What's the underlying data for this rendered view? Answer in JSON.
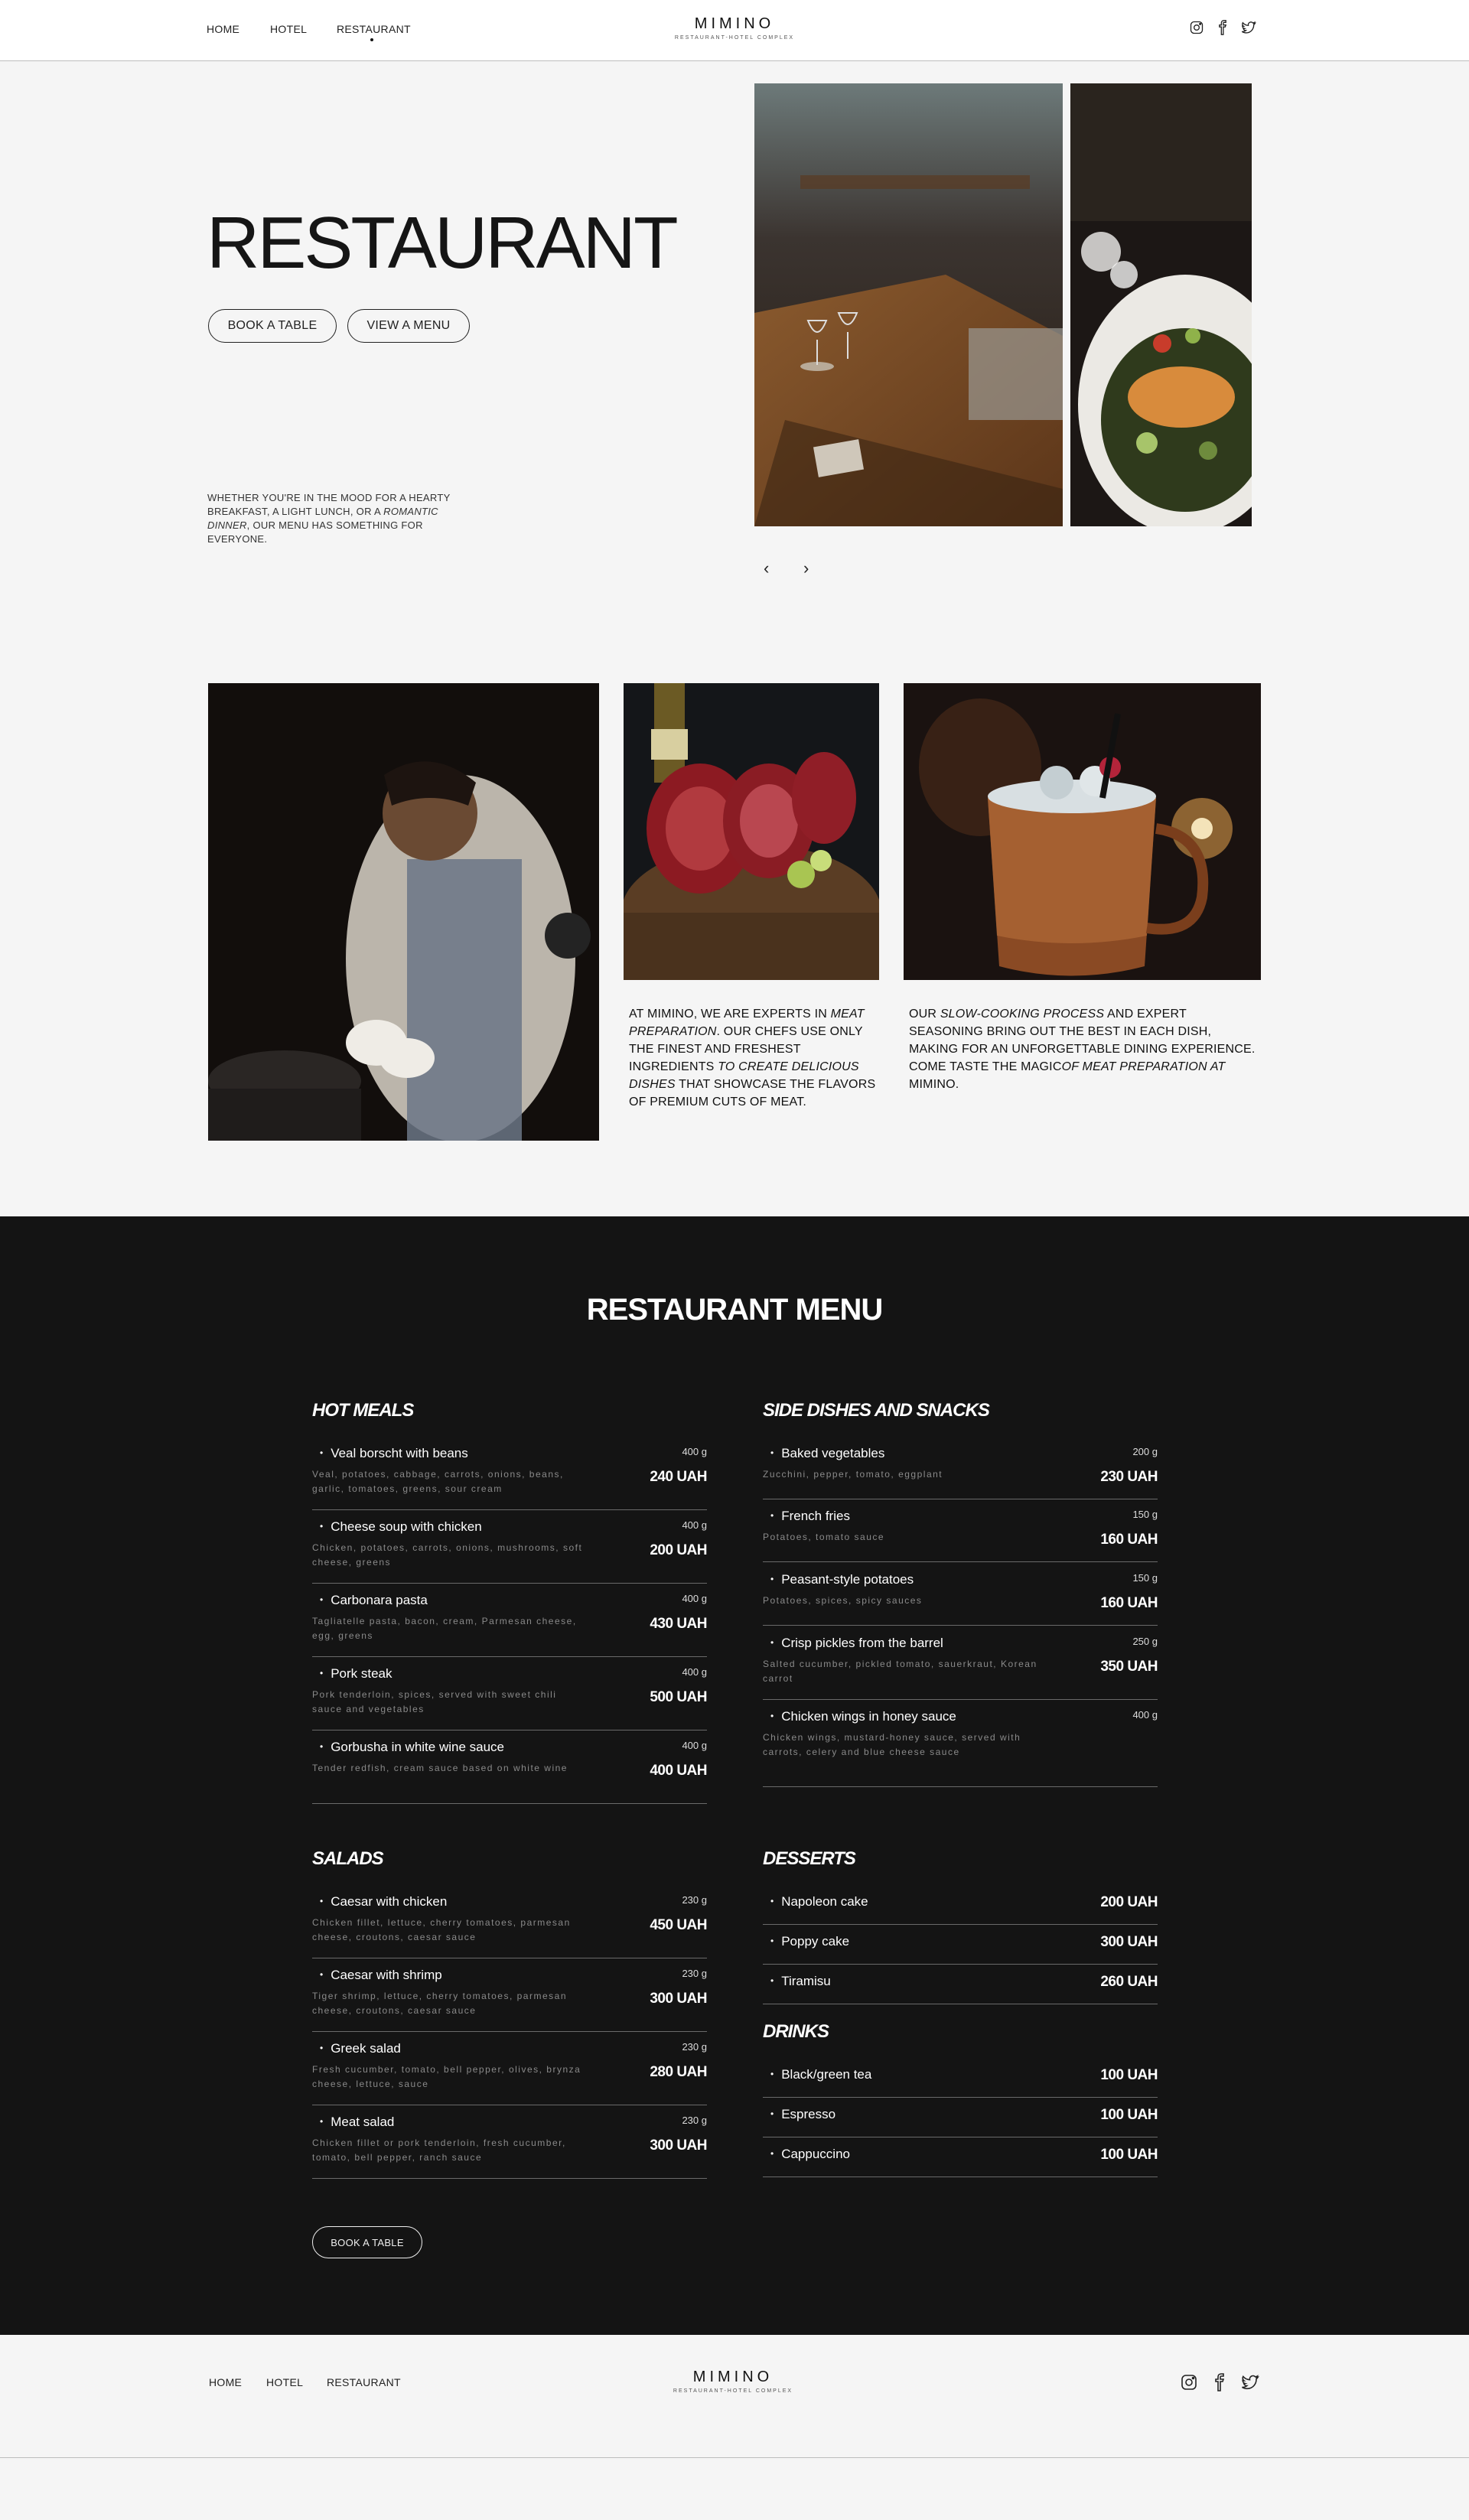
{
  "header": {
    "nav": [
      "HOME",
      "HOTEL",
      "RESTAURANT"
    ],
    "logo": "MIMINO",
    "logo_sub": "RESTAURANT-HOTEL COMPLEX"
  },
  "hero": {
    "title": "RESTAURANT",
    "book_btn": "BOOK A TABLE",
    "menu_btn": "VIEW A MENU",
    "desc_1": "WHETHER YOU'RE IN THE MOOD FOR A HEARTY BREAKFAST, A LIGHT LUNCH, OR A ",
    "desc_italic": "ROMANTIC DINNER",
    "desc_2": ", OUR MENU HAS SOMETHING FOR EVERYONE.",
    "prev_arrow": "‹",
    "next_arrow": "›"
  },
  "features": {
    "text1": {
      "a": "AT MIMINO, WE ARE EXPERTS IN ",
      "b": "MEAT PREPARATION",
      "c": ". OUR CHEFS USE ONLY THE FINEST AND FRESHEST INGREDIENTS ",
      "d": "TO CREATE DELICIOUS DISHES",
      "e": " THAT SHOWCASE THE FLAVORS OF PREMIUM CUTS OF MEAT."
    },
    "text2": {
      "a": "OUR ",
      "b": "SLOW-COOKING PROCESS",
      "c": " AND EXPERT SEASONING BRING OUT THE BEST IN EACH DISH, MAKING FOR AN UNFORGETTABLE DINING EXPERIENCE. COME TASTE THE MAGIC",
      "d": "OF MEAT PREPARATION AT",
      "e": " MIMINO."
    }
  },
  "menu": {
    "title": "RESTAURANT MENU",
    "hot_meals": {
      "title": "HOT MEALS",
      "items": [
        {
          "name": "Veal borscht with beans",
          "weight": "400 g",
          "price": "240 UAH",
          "desc": "Veal, potatoes, cabbage, carrots, onions, beans, garlic, tomatoes, greens, sour cream"
        },
        {
          "name": "Cheese soup with chicken",
          "weight": "400 g",
          "price": "200 UAH",
          "desc": "Chicken, potatoes, carrots, onions, mushrooms, soft cheese, greens"
        },
        {
          "name": "Carbonara pasta",
          "weight": "400 g",
          "price": "430 UAH",
          "desc": "Tagliatelle pasta, bacon, cream, Parmesan cheese, egg, greens"
        },
        {
          "name": "Pork steak",
          "weight": "400 g",
          "price": "500 UAH",
          "desc": "Pork tenderloin, spices, served with sweet chili sauce and vegetables"
        },
        {
          "name": "Gorbusha in white wine sauce",
          "weight": "400 g",
          "price": "400 UAH",
          "desc": "Tender redfish, cream sauce based on white wine"
        }
      ]
    },
    "sides": {
      "title": "SIDE DISHES AND SNACKS",
      "items": [
        {
          "name": "Baked vegetables",
          "weight": "200 g",
          "price": "230 UAH",
          "desc": "Zucchini, pepper, tomato, eggplant"
        },
        {
          "name": "French fries",
          "weight": "150 g",
          "price": "160 UAH",
          "desc": "Potatoes, tomato sauce"
        },
        {
          "name": "Peasant-style potatoes",
          "weight": "150 g",
          "price": "160 UAH",
          "desc": "Potatoes, spices, spicy sauces"
        },
        {
          "name": "Crisp pickles from the barrel",
          "weight": "250 g",
          "price": "350 UAH",
          "desc": "Salted cucumber, pickled tomato, sauerkraut, Korean carrot"
        },
        {
          "name": "Chicken wings in honey sauce",
          "weight": "400 g",
          "price": "",
          "desc": "Chicken wings, mustard-honey sauce, served with carrots, celery and blue cheese sauce"
        }
      ]
    },
    "salads": {
      "title": "SALADS",
      "items": [
        {
          "name": "Caesar with chicken",
          "weight": "230 g",
          "price": "450 UAH",
          "desc": "Chicken fillet, lettuce, cherry tomatoes, parmesan cheese, croutons, caesar sauce"
        },
        {
          "name": "Caesar with shrimp",
          "weight": "230 g",
          "price": "300 UAH",
          "desc": "Tiger shrimp, lettuce, cherry tomatoes, parmesan cheese, croutons, caesar sauce"
        },
        {
          "name": "Greek salad",
          "weight": "230 g",
          "price": "280 UAH",
          "desc": "Fresh cucumber, tomato, bell pepper, olives, brynza cheese, lettuce, sauce"
        },
        {
          "name": "Meat salad",
          "weight": "230 g",
          "price": "300 UAH",
          "desc": "Chicken fillet or pork tenderloin, fresh cucumber, tomato, bell pepper, ranch sauce"
        }
      ]
    },
    "desserts": {
      "title": "DESSERTS",
      "items": [
        {
          "name": "Napoleon cake",
          "price": "200 UAH"
        },
        {
          "name": "Poppy cake",
          "price": "300 UAH"
        },
        {
          "name": "Tiramisu",
          "price": "260 UAH"
        }
      ]
    },
    "drinks": {
      "title": "DRINKS",
      "items": [
        {
          "name": "Black/green tea",
          "price": "100 UAH"
        },
        {
          "name": "Espresso",
          "price": "100 UAH"
        },
        {
          "name": "Cappuccino",
          "price": "100 UAH"
        }
      ]
    },
    "book_btn": "BOOK A TABLE"
  },
  "footer": {
    "nav": [
      "HOME",
      "HOTEL",
      "RESTAURANT"
    ],
    "logo": "MIMINO",
    "logo_sub": "RESTAURANT-HOTEL COMPLEX"
  },
  "colors": {
    "page_bg": "#f5f5f5",
    "menu_bg": "#141414",
    "text": "#161616"
  },
  "icons": [
    "instagram-icon",
    "facebook-icon",
    "twitter-icon",
    "chevron-left-icon",
    "chevron-right-icon"
  ]
}
